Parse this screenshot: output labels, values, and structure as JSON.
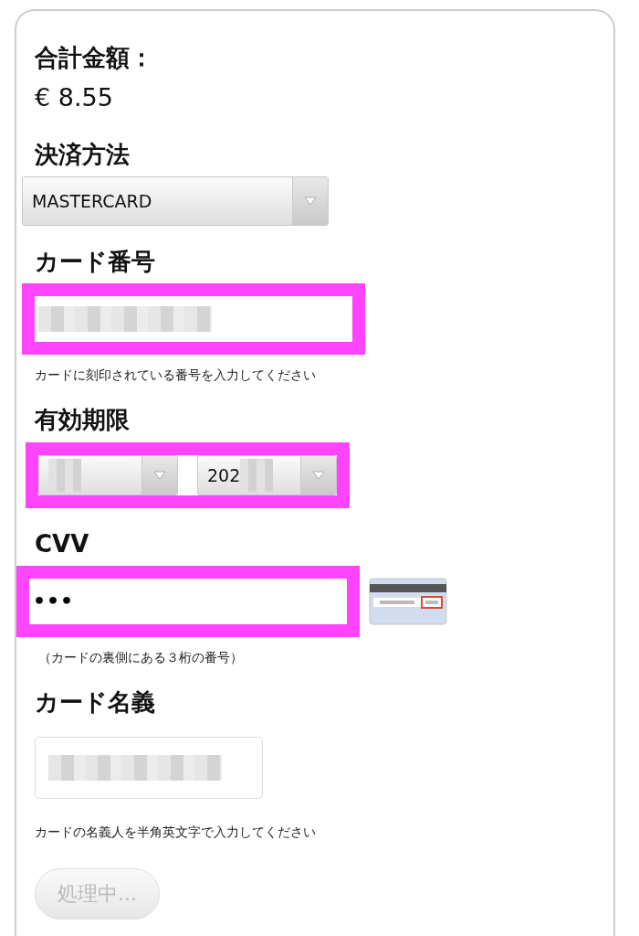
{
  "total": {
    "label": "合計金額：",
    "amount": "€ 8.55"
  },
  "fields": [
    {
      "kind": "select",
      "label": "決済方法",
      "value": "MASTERCARD",
      "highlighted": false
    },
    {
      "kind": "text",
      "label": "カード番号",
      "redacted": true,
      "highlighted": true,
      "hint": "カードに刻印されている番号を入力してください"
    },
    {
      "kind": "date",
      "label": "有効期限",
      "highlighted": true,
      "selects": [
        {
          "redacted": true
        },
        {
          "value": "202",
          "redacted": true
        }
      ]
    },
    {
      "kind": "cvv",
      "label": "CVV",
      "value": "•••",
      "highlighted": true,
      "hint": "（カードの裏側にある３桁の番号）"
    },
    {
      "kind": "name",
      "label": "カード名義",
      "redacted": true,
      "highlighted": false,
      "hint": "カードの名義人を半角英文字で入力してください"
    }
  ],
  "button": {
    "label": "処理中...",
    "disabled": true
  }
}
